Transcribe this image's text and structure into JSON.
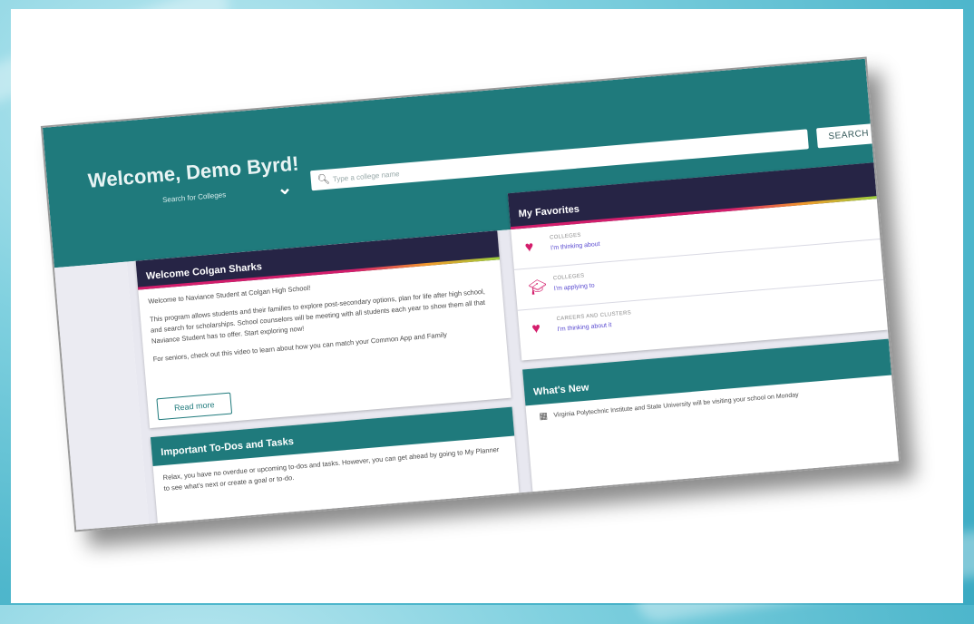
{
  "header": {
    "welcome": "Welcome, Demo Byrd!",
    "dropdown_label": "Search for Colleges",
    "search_placeholder": "Type a college name",
    "search_button": "SEARCH"
  },
  "welcome_card": {
    "title": "Welcome Colgan Sharks",
    "paragraphs": [
      "Welcome to Naviance Student at Colgan High School!",
      "This program allows students and their families to explore post-secondary options, plan for life after high school, and search for scholarships. School counselors will be meeting with all students each year to show them all that Naviance Student has to offer. Start exploring now!",
      "For seniors, check out this video to learn about how you can match your Common App and Family"
    ],
    "read_more": "Read more"
  },
  "todos_card": {
    "title": "Important To-Dos and Tasks",
    "text": "Relax, you have no overdue or upcoming to-dos and tasks. However, you can get ahead by going to My Planner to see what's next or create a goal or to-do."
  },
  "favorites": {
    "title": "My Favorites",
    "items": [
      {
        "category": "COLLEGES",
        "status": "I'm thinking about",
        "icon": "heart-icon"
      },
      {
        "category": "COLLEGES",
        "status": "I'm applying to",
        "icon": "graduation-cap-icon"
      },
      {
        "category": "CAREERS AND CLUSTERS",
        "status": "I'm thinking about it",
        "icon": "heart-icon"
      }
    ]
  },
  "whats_new": {
    "title": "What's New",
    "item": "Virginia Polytechnic Institute and State University will be visiting your school on Monday"
  },
  "colors": {
    "teal": "#1f7a7c",
    "navy": "#262445",
    "magenta": "#d41e6c",
    "link": "#5a4bd1"
  }
}
